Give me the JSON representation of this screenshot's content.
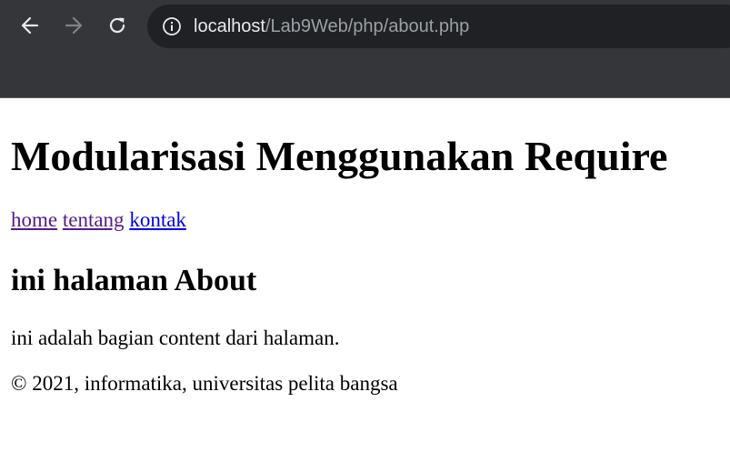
{
  "browser": {
    "url_host": "localhost",
    "url_path": "/Lab9Web/php/about.php",
    "icons": {
      "back": "arrow-left-icon",
      "forward": "arrow-right-icon",
      "reload": "reload-icon",
      "site_info": "info-icon"
    },
    "colors": {
      "toolbar": "#35363a",
      "omnibox": "#202124",
      "url_host": "#e8eaed",
      "url_path": "#9aa0a6"
    }
  },
  "page": {
    "title": "Modularisasi Menggunakan Require",
    "nav": [
      {
        "label": "home",
        "visited": true
      },
      {
        "label": "tentang",
        "visited": true
      },
      {
        "label": "kontak",
        "visited": false
      }
    ],
    "section_title": "ini halaman About",
    "content": "ini adalah bagian content dari halaman.",
    "footer": "© 2021, informatika, universitas pelita bangsa"
  },
  "colors": {
    "link_visited": "#551a8b",
    "link_unvisited": "#0000ee"
  }
}
